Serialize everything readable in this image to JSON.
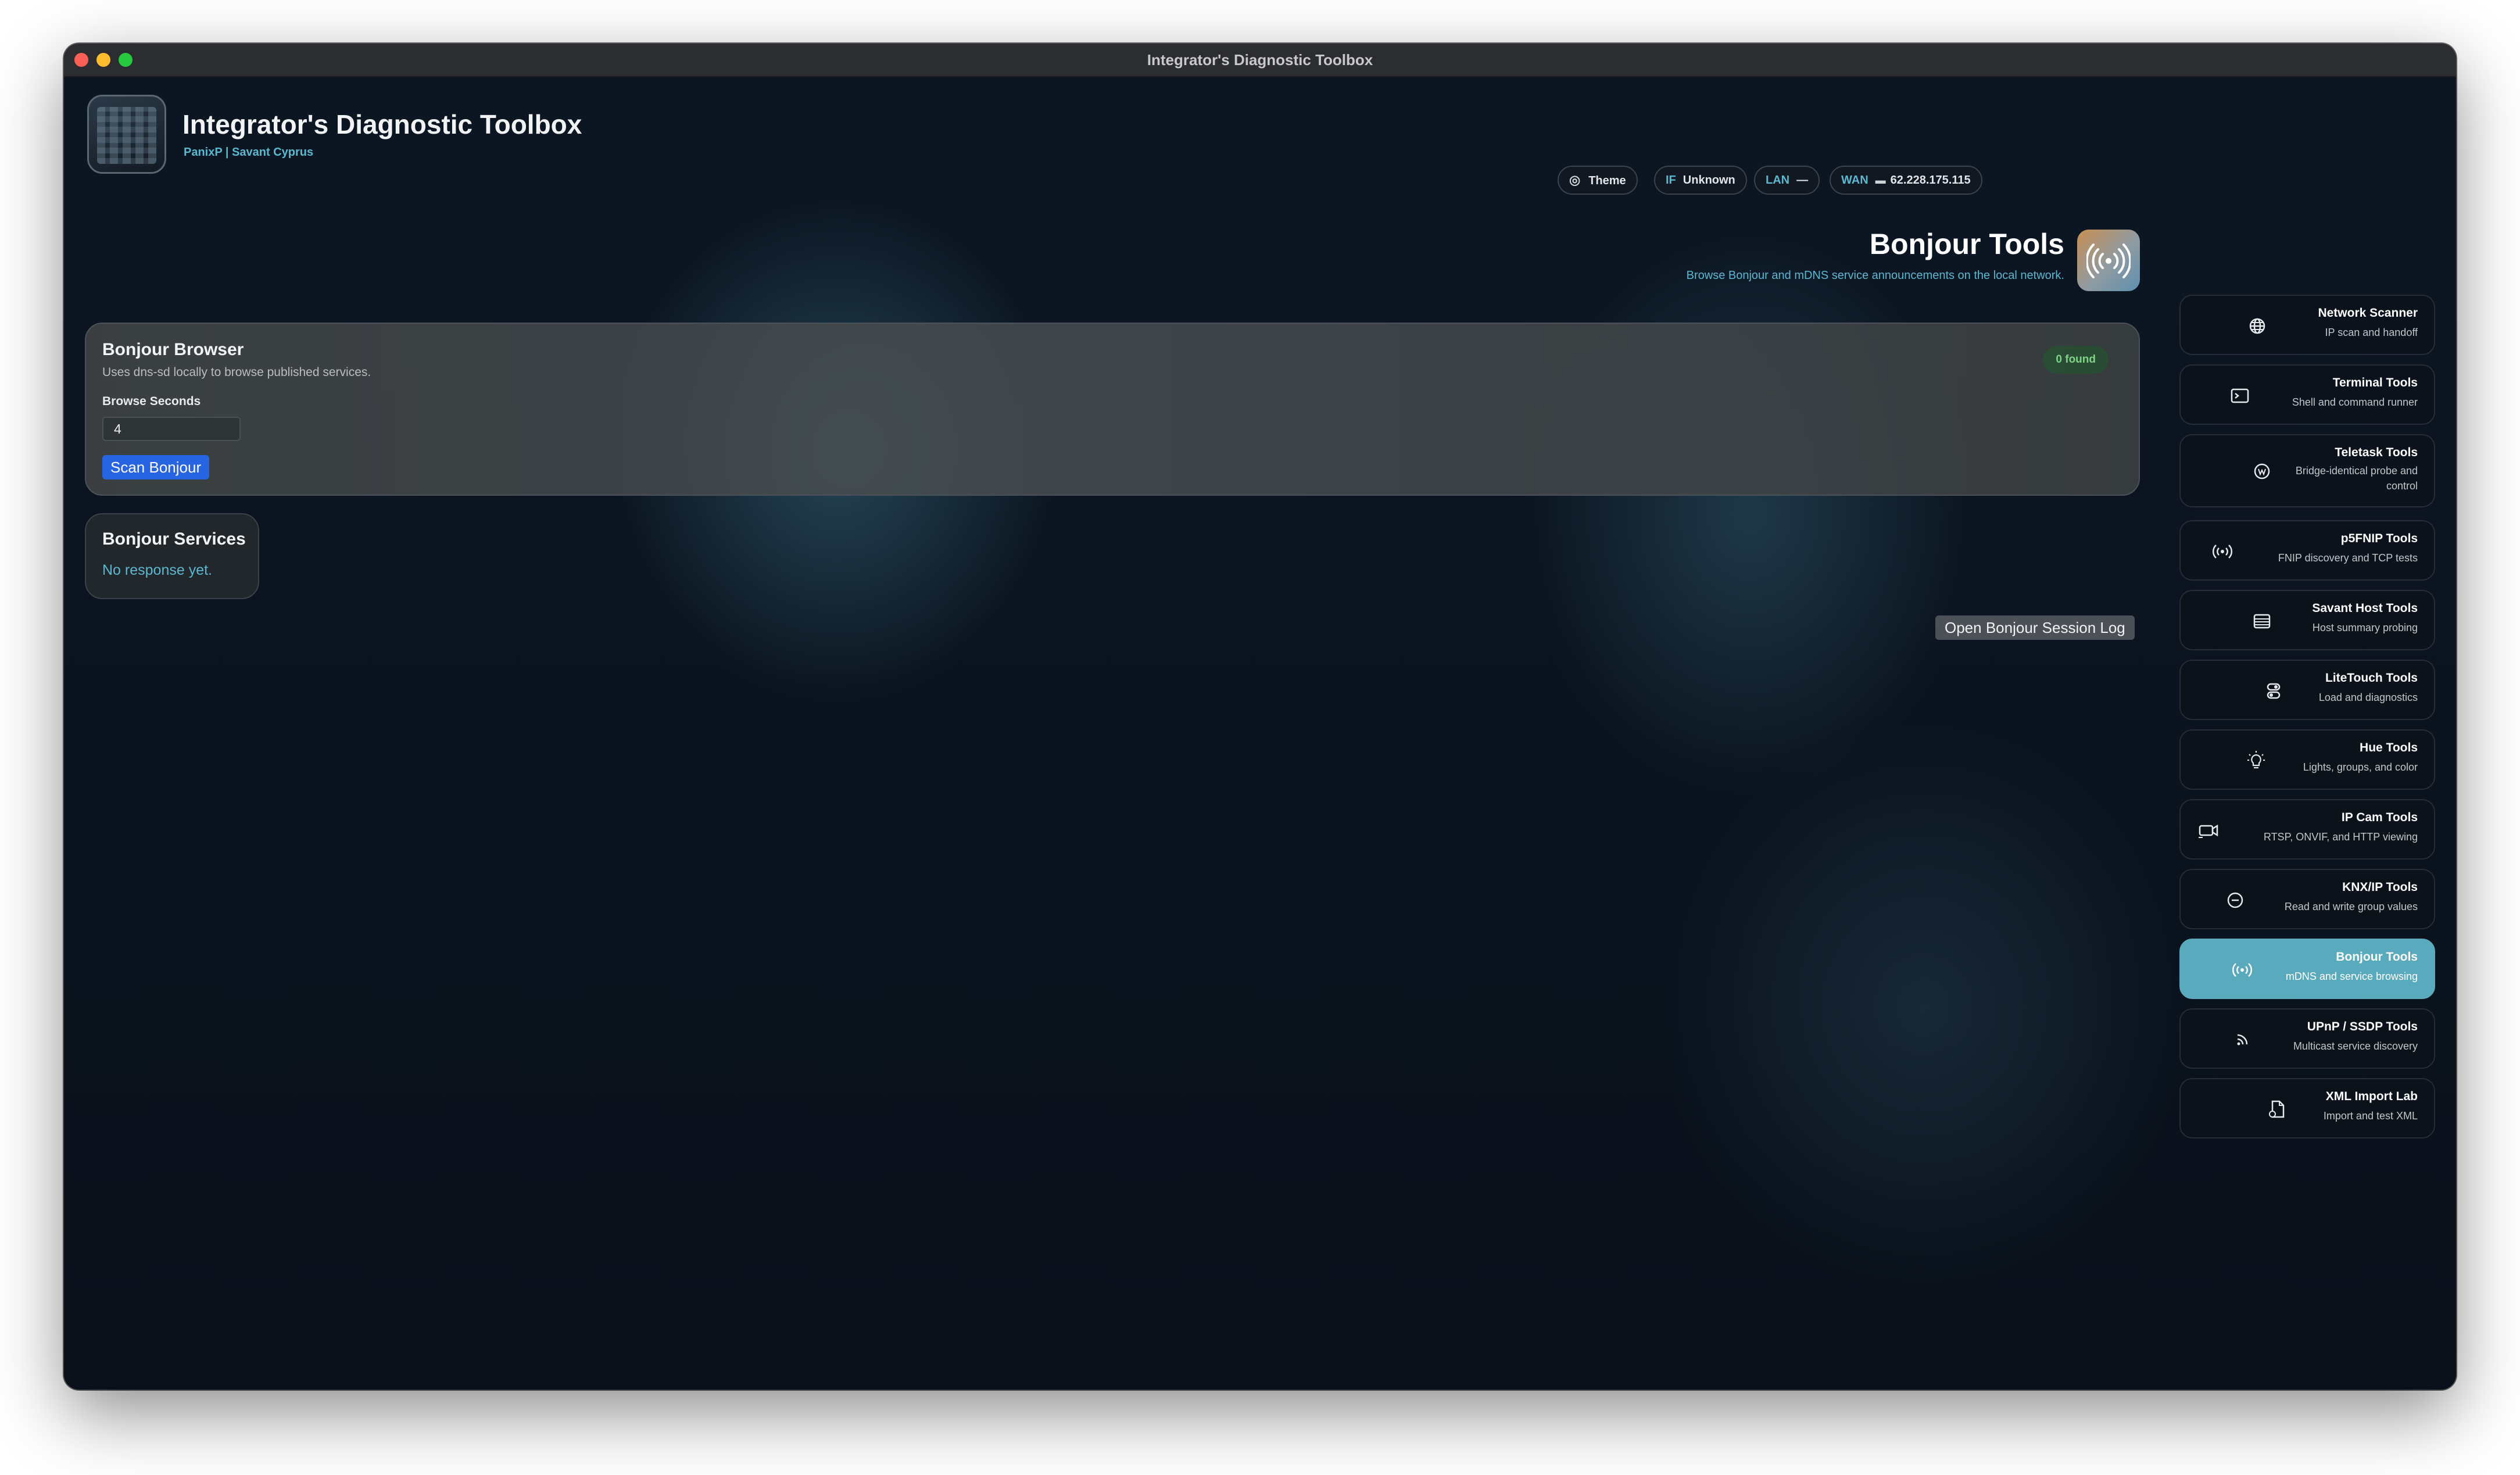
{
  "window": {
    "title": "Integrator's Diagnostic Toolbox"
  },
  "header": {
    "app_title": "Integrator's Diagnostic Toolbox",
    "app_subtitle": "PanixP | Savant Cyprus",
    "theme_label": "Theme",
    "if_label": "IF",
    "if_value": "Unknown",
    "lan_label": "LAN",
    "lan_value": "—",
    "wan_label": "WAN",
    "wan_value": "62.228.175.115"
  },
  "page": {
    "title": "Bonjour Tools",
    "subtitle": "Browse Bonjour and mDNS service announcements on the local network."
  },
  "browser_card": {
    "title": "Bonjour Browser",
    "note": "Uses dns-sd locally to browse published services.",
    "field_label": "Browse Seconds",
    "field_value": "4",
    "scan_button": "Scan Bonjour",
    "found_badge": "0 found"
  },
  "services_card": {
    "title": "Bonjour Services",
    "status": "No response yet."
  },
  "session_log_button": "Open Bonjour Session Log",
  "sidebar": {
    "items": [
      {
        "title": "Network Scanner",
        "desc": "IP scan and handoff",
        "icon": "globe-icon"
      },
      {
        "title": "Terminal Tools",
        "desc": "Shell and command runner",
        "icon": "terminal-icon"
      },
      {
        "title": "Teletask Tools",
        "desc": "Bridge-identical probe and control",
        "icon": "teletask-icon"
      },
      {
        "title": "p5FNIP Tools",
        "desc": "FNIP discovery and TCP tests",
        "icon": "antenna-icon"
      },
      {
        "title": "Savant Host Tools",
        "desc": "Host summary probing",
        "icon": "server-icon"
      },
      {
        "title": "LiteTouch Tools",
        "desc": "Load and diagnostics",
        "icon": "switches-icon"
      },
      {
        "title": "Hue Tools",
        "desc": "Lights, groups, and color",
        "icon": "lightbulb-icon"
      },
      {
        "title": "IP Cam Tools",
        "desc": "RTSP, ONVIF, and HTTP viewing",
        "icon": "camera-icon"
      },
      {
        "title": "KNX/IP Tools",
        "desc": "Read and write group values",
        "icon": "knx-icon"
      },
      {
        "title": "Bonjour Tools",
        "desc": "mDNS and service browsing",
        "icon": "broadcast-icon"
      },
      {
        "title": "UPnP / SSDP Tools",
        "desc": "Multicast service discovery",
        "icon": "wifi-icon"
      },
      {
        "title": "XML Import Lab",
        "desc": "Import and test XML",
        "icon": "document-icon"
      }
    ],
    "active_index": 9
  },
  "colors": {
    "accent": "#5ab8d0",
    "active_nav": "#5aaabe",
    "scan_button": "#2664e2",
    "found_badge_text": "#7ed386"
  }
}
